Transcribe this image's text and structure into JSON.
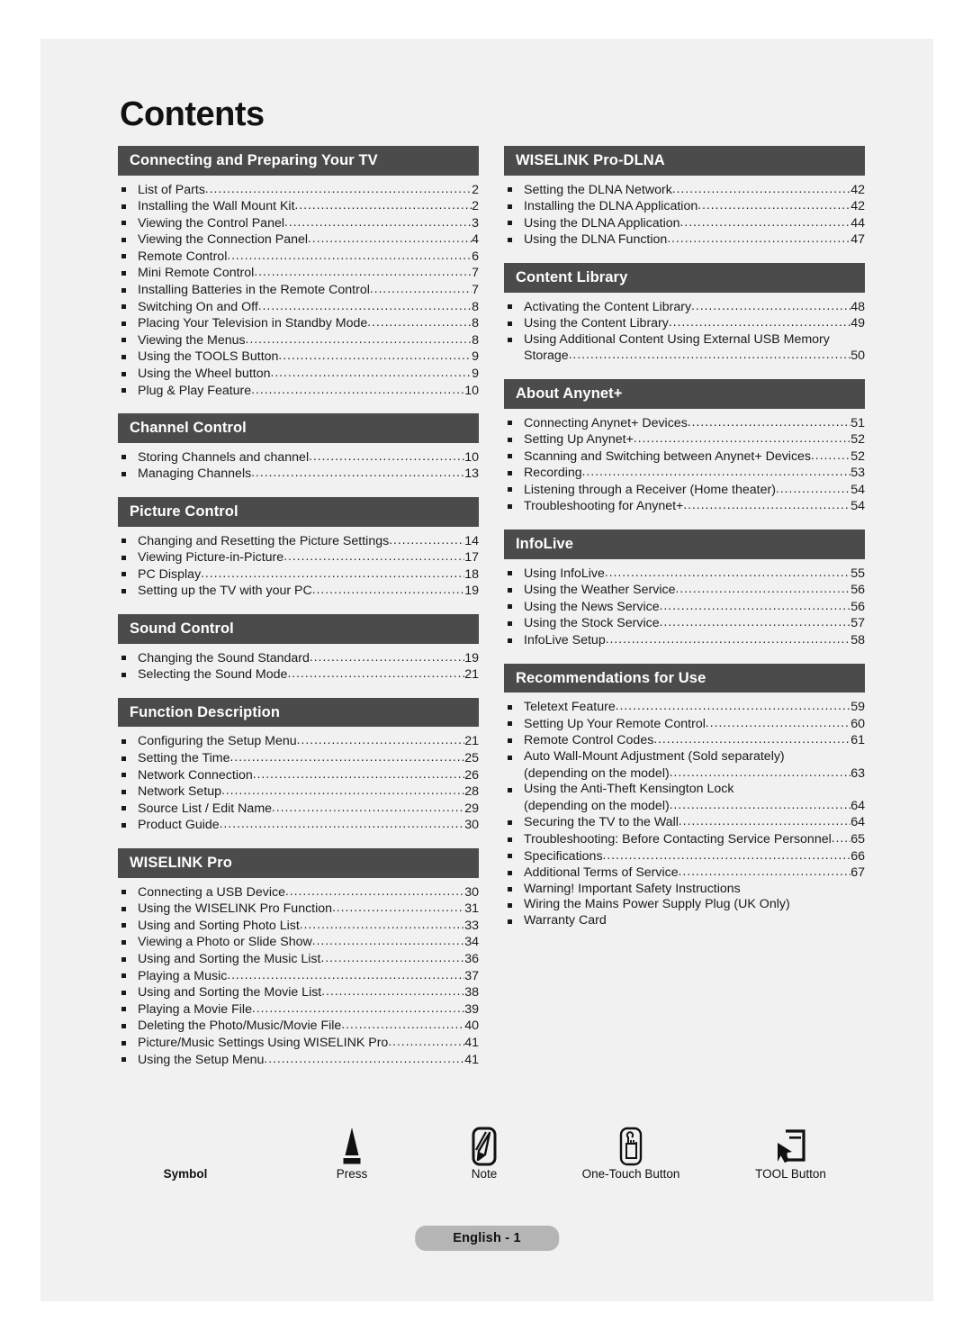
{
  "document": {
    "title": "Contents",
    "footer_badge": "English - 1"
  },
  "columns": {
    "left": [
      {
        "header": "Connecting and Preparing Your TV",
        "items": [
          {
            "label": "List of Parts",
            "page": "2"
          },
          {
            "label": "Installing the Wall Mount Kit",
            "page": "2"
          },
          {
            "label": "Viewing the Control Panel",
            "page": "3"
          },
          {
            "label": "Viewing the Connection Panel",
            "page": "4"
          },
          {
            "label": "Remote Control",
            "page": "6"
          },
          {
            "label": "Mini Remote Control",
            "page": "7"
          },
          {
            "label": "Installing Batteries in the Remote Control",
            "page": "7"
          },
          {
            "label": "Switching On and Off",
            "page": "8"
          },
          {
            "label": "Placing Your Television in Standby Mode",
            "page": "8"
          },
          {
            "label": "Viewing the Menus",
            "page": "8"
          },
          {
            "label": "Using the TOOLS Button",
            "page": "9"
          },
          {
            "label": "Using the Wheel button",
            "page": "9"
          },
          {
            "label": "Plug & Play Feature",
            "page": "10"
          }
        ]
      },
      {
        "header": "Channel Control",
        "items": [
          {
            "label": "Storing Channels and channel",
            "page": "10"
          },
          {
            "label": "Managing Channels",
            "page": "13"
          }
        ]
      },
      {
        "header": "Picture Control",
        "items": [
          {
            "label": "Changing and Resetting the Picture Settings",
            "page": "14"
          },
          {
            "label": "Viewing Picture-in-Picture",
            "page": "17"
          },
          {
            "label": "PC Display",
            "page": "18"
          },
          {
            "label": "Setting up the TV with your PC",
            "page": "19"
          }
        ]
      },
      {
        "header": "Sound Control",
        "items": [
          {
            "label": "Changing the Sound Standard",
            "page": "19"
          },
          {
            "label": "Selecting the Sound Mode",
            "page": "21"
          }
        ]
      },
      {
        "header": "Function Description",
        "items": [
          {
            "label": "Configuring the Setup Menu",
            "page": "21"
          },
          {
            "label": "Setting the Time",
            "page": "25"
          },
          {
            "label": "Network Connection",
            "page": "26"
          },
          {
            "label": "Network Setup",
            "page": "28"
          },
          {
            "label": "Source List / Edit Name",
            "page": "29"
          },
          {
            "label": "Product Guide",
            "page": "30"
          }
        ]
      },
      {
        "header": "WISELINK Pro",
        "items": [
          {
            "label": "Connecting a USB Device",
            "page": "30"
          },
          {
            "label": "Using the WISELINK Pro Function",
            "page": "31"
          },
          {
            "label": "Using and Sorting Photo List",
            "page": "33"
          },
          {
            "label": "Viewing a Photo or Slide Show",
            "page": "34"
          },
          {
            "label": "Using and Sorting the Music List",
            "page": "36"
          },
          {
            "label": "Playing a Music",
            "page": "37"
          },
          {
            "label": "Using and Sorting the Movie List",
            "page": "38"
          },
          {
            "label": "Playing a Movie File",
            "page": "39"
          },
          {
            "label": "Deleting the Photo/Music/Movie File",
            "page": "40"
          },
          {
            "label": "Picture/Music Settings Using WISELINK Pro",
            "page": "41"
          },
          {
            "label": "Using the Setup Menu",
            "page": "41"
          }
        ]
      }
    ],
    "right": [
      {
        "header": "WISELINK Pro-DLNA",
        "items": [
          {
            "label": "Setting the DLNA Network",
            "page": "42"
          },
          {
            "label": "Installing the DLNA Application",
            "page": "42"
          },
          {
            "label": "Using the DLNA Application",
            "page": "44"
          },
          {
            "label": "Using the DLNA Function",
            "page": "47"
          }
        ]
      },
      {
        "header": "Content Library",
        "items": [
          {
            "label": "Activating the Content Library",
            "page": "48"
          },
          {
            "label": "Using the Content Library",
            "page": "49"
          },
          {
            "label": "Using Additional Content Using External USB Memory",
            "page": "",
            "continuation": "Storage",
            "continuation_page": "50"
          }
        ]
      },
      {
        "header": "About Anynet+",
        "items": [
          {
            "label": "Connecting Anynet+ Devices",
            "page": "51"
          },
          {
            "label": "Setting Up Anynet+",
            "page": "52"
          },
          {
            "label": "Scanning and Switching between Anynet+ Devices",
            "page": "52"
          },
          {
            "label": "Recording",
            "page": "53"
          },
          {
            "label": "Listening through a Receiver (Home theater)",
            "page": "54"
          },
          {
            "label": "Troubleshooting for Anynet+",
            "page": "54"
          }
        ]
      },
      {
        "header": "InfoLive",
        "items": [
          {
            "label": "Using InfoLive",
            "page": "55"
          },
          {
            "label": "Using the Weather Service",
            "page": "56"
          },
          {
            "label": "Using the News Service",
            "page": "56"
          },
          {
            "label": "Using the Stock Service",
            "page": "57"
          },
          {
            "label": "InfoLive Setup",
            "page": "58"
          }
        ]
      },
      {
        "header": "Recommendations for Use",
        "items": [
          {
            "label": "Teletext Feature",
            "page": "59"
          },
          {
            "label": "Setting Up Your Remote Control",
            "page": "60"
          },
          {
            "label": "Remote Control Codes",
            "page": "61"
          },
          {
            "label": "Auto Wall-Mount Adjustment (Sold separately)",
            "page": "",
            "continuation": "(depending on the model)",
            "continuation_page": "63"
          },
          {
            "label": "Using the Anti-Theft Kensington Lock",
            "page": "",
            "continuation": "(depending on the model)",
            "continuation_page": "64"
          },
          {
            "label": "Securing the TV to the Wall",
            "page": "64"
          },
          {
            "label": "Troubleshooting: Before Contacting Service Personnel",
            "page": "65"
          },
          {
            "label": "Specifications",
            "page": "66"
          },
          {
            "label": "Additional Terms of Service",
            "page": "67"
          },
          {
            "label": "Warning! Important Safety Instructions",
            "page": ""
          },
          {
            "label": "Wiring the Mains Power Supply Plug (UK Only)",
            "page": ""
          },
          {
            "label": "Warranty Card",
            "page": ""
          }
        ]
      }
    ]
  },
  "legend": {
    "title": "Symbol",
    "entries": [
      {
        "icon": "press-triangle-icon",
        "caption": "Press"
      },
      {
        "icon": "note-pencil-icon",
        "caption": "Note"
      },
      {
        "icon": "one-touch-button-icon",
        "caption": "One-Touch Button"
      },
      {
        "icon": "tool-button-icon",
        "caption": "TOOL Button"
      }
    ]
  },
  "colors": {
    "page_background": "#f1f1f1",
    "section_header_bg": "#4b4b4b",
    "section_header_text": "#ffffff",
    "body_text": "#1a1a1a",
    "footer_badge_bg": "#b5b5b5"
  }
}
